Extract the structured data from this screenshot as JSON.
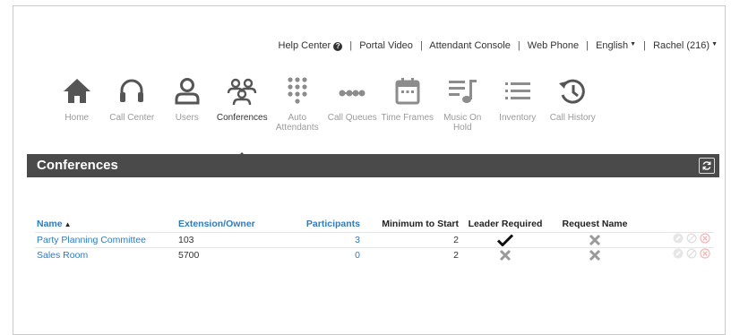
{
  "top_links": {
    "help_center": "Help Center",
    "portal_video": "Portal Video",
    "attendant_console": "Attendant Console",
    "web_phone": "Web Phone",
    "language": "English",
    "user": "Rachel (216)"
  },
  "nav": {
    "items": [
      {
        "label": "Home",
        "icon": "home-icon"
      },
      {
        "label": "Call Center",
        "icon": "headset-icon"
      },
      {
        "label": "Users",
        "icon": "user-icon"
      },
      {
        "label": "Conferences",
        "icon": "group-icon"
      },
      {
        "label": "Auto Attendants",
        "icon": "keypad-icon"
      },
      {
        "label": "Call Queues",
        "icon": "queue-dots-icon"
      },
      {
        "label": "Time Frames",
        "icon": "calendar-icon"
      },
      {
        "label": "Music On Hold",
        "icon": "music-note-icon"
      },
      {
        "label": "Inventory",
        "icon": "list-icon"
      },
      {
        "label": "Call History",
        "icon": "history-icon"
      }
    ],
    "active": "Conferences"
  },
  "header": {
    "title": "Conferences",
    "refresh_icon": "refresh-icon"
  },
  "table": {
    "columns": {
      "name": "Name",
      "extension_owner": "Extension/Owner",
      "participants": "Participants",
      "minimum_to_start": "Minimum to Start",
      "leader_required": "Leader Required",
      "request_name": "Request Name"
    },
    "sort_column": "name",
    "sort_direction": "ascending",
    "rows": [
      {
        "name": "Party Planning Committee",
        "extension": "103",
        "participants": "3",
        "minimum": "2",
        "leader_required": true,
        "request_name": false
      },
      {
        "name": "Sales Room",
        "extension": "5700",
        "participants": "0",
        "minimum": "2",
        "leader_required": false,
        "request_name": false
      }
    ]
  },
  "colors": {
    "link_blue": "#2f7bbf",
    "header_bar": "#4a4a4a",
    "icon_gray": "#8c8c8c",
    "icon_dark": "#555555"
  }
}
